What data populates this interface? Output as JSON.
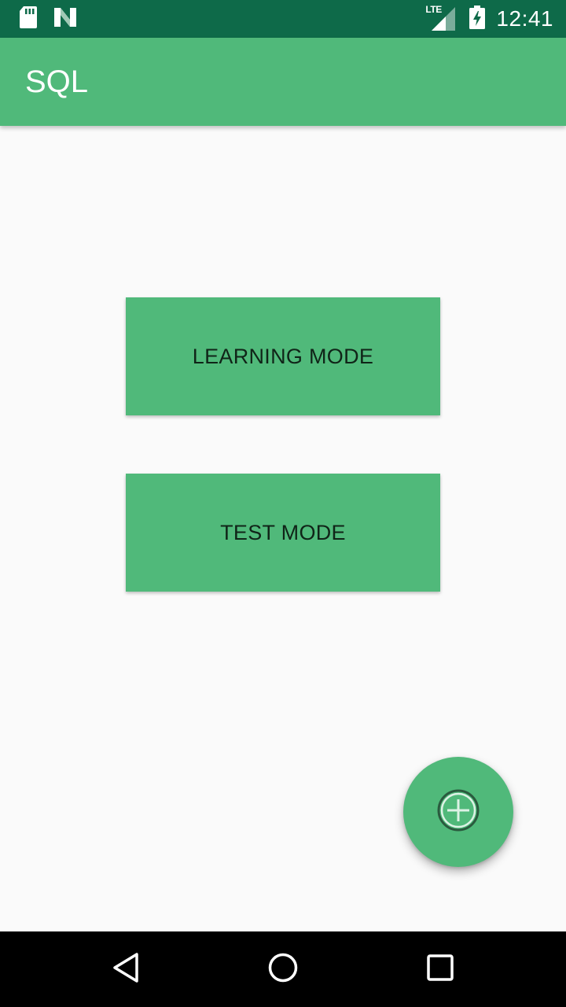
{
  "status_bar": {
    "time": "12:41",
    "network_label": "LTE",
    "icons": [
      "sd-card-icon",
      "n-notification-icon",
      "lte-signal-icon",
      "battery-charging-icon"
    ],
    "background": "#0E6A49"
  },
  "app_bar": {
    "title": "SQL",
    "background": "#50B97A"
  },
  "main": {
    "learning_mode_label": "LEARNING MODE",
    "test_mode_label": "TEST MODE",
    "button_color": "#50B97A",
    "fab_icon": "add-circle-icon"
  },
  "nav_bar": {
    "icons": [
      "back-icon",
      "home-icon",
      "recents-icon"
    ],
    "background": "#000000"
  }
}
